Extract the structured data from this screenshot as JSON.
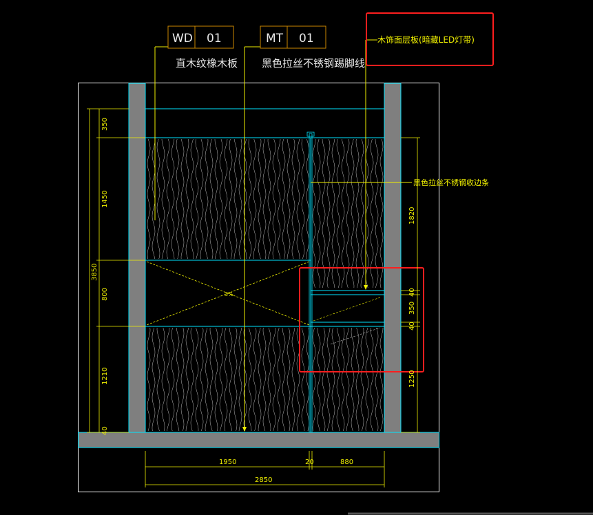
{
  "colors": {
    "background": "#000000",
    "frame": "#ffffff",
    "wall": "#7f7f7f",
    "outline": "#00e5ff",
    "dimension": "#f0f000",
    "tag_border": "#cc8800",
    "highlight": "#ff1e1e",
    "hatch": "#bfbfbf"
  },
  "tags": [
    {
      "code": "WD",
      "number": "01",
      "description": "直木纹橡木板"
    },
    {
      "code": "MT",
      "number": "01",
      "description": "黑色拉丝不锈钢踢脚线"
    }
  ],
  "callouts": {
    "top_right": "木饰面层板(暗藏LED灯带)",
    "right_strip": "黑色拉丝不锈钢收边条",
    "center_mark": "3%"
  },
  "dimensions": {
    "left": [
      "350",
      "1450",
      "800",
      "1210",
      "40"
    ],
    "left_total": "3850",
    "right": [
      "1820",
      "40",
      "350",
      "40",
      "1250"
    ],
    "bottom": [
      "1950",
      "20",
      "880"
    ],
    "bottom_total": "2850"
  },
  "icons": {
    "leader_arrow": "arrow-head-icon"
  }
}
